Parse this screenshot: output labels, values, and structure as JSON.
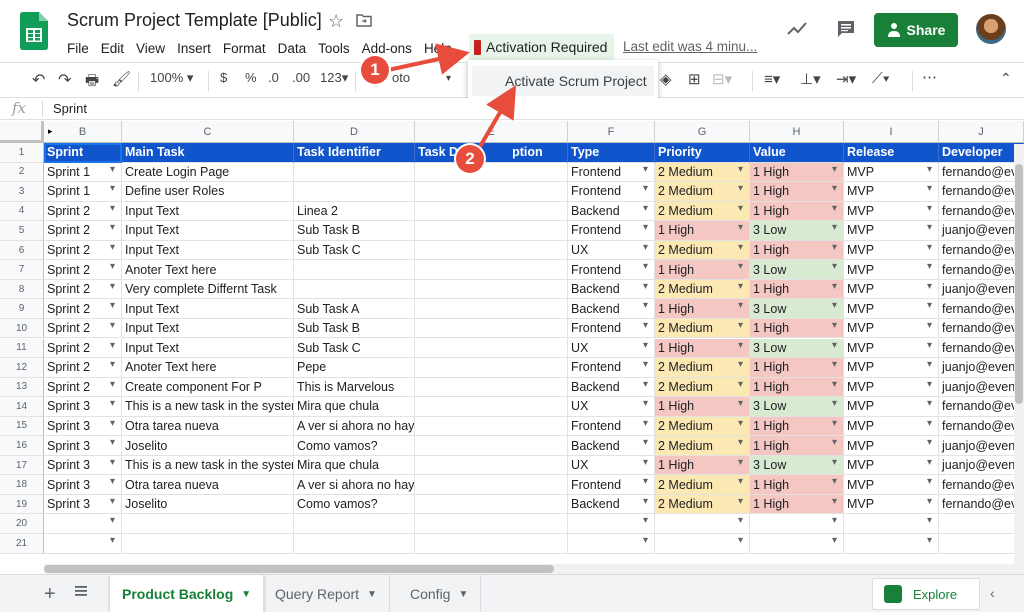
{
  "header": {
    "title": "Scrum Project Template [Public]",
    "menus": [
      "File",
      "Edit",
      "View",
      "Insert",
      "Format",
      "Data",
      "Tools",
      "Add-ons",
      "Help"
    ],
    "activation_menu": "Activation Required",
    "last_edit": "Last edit was 4 minu...",
    "share_label": "Share",
    "icons": [
      "sheets-logo-icon",
      "star-icon",
      "folder-icon",
      "trend-icon",
      "comment-icon",
      "person-icon"
    ]
  },
  "toolbar": {
    "zoom": "100%",
    "currency": "$",
    "percent": "%",
    "decimal_decrease": ".0",
    "decimal_increase": ".00",
    "more_formats": "123",
    "font": "oto",
    "more": "⋯"
  },
  "dropdown": {
    "item": "Activate Scrum Project"
  },
  "formula_bar": {
    "fx": "fx",
    "value": "Sprint"
  },
  "grid": {
    "column_letters": [
      "B",
      "C",
      "D",
      "E",
      "F",
      "G",
      "H",
      "I",
      "J"
    ],
    "headers": [
      "Sprint",
      "Main Task",
      "Task Identifier",
      "Task D",
      "ption",
      "Type",
      "Priority",
      "Value",
      "Release",
      "Developer"
    ],
    "rows": [
      {
        "n": "2",
        "sprint": "Sprint 1",
        "task": "Create Login Page",
        "id": "",
        "type": "Frontend",
        "priority": "2 Medium",
        "value": "1 High",
        "release": "MVP",
        "dev": "fernando@evenl"
      },
      {
        "n": "3",
        "sprint": "Sprint 1",
        "task": "Define user Roles",
        "id": "",
        "type": "Frontend",
        "priority": "2 Medium",
        "value": "1 High",
        "release": "MVP",
        "dev": "fernando@evenl"
      },
      {
        "n": "4",
        "sprint": "Sprint 2",
        "task": "Input Text",
        "id": "Linea 2",
        "type": "Backend",
        "priority": "2 Medium",
        "value": "1 High",
        "release": "MVP",
        "dev": "fernando@evenl"
      },
      {
        "n": "5",
        "sprint": "Sprint 2",
        "task": "Input Text",
        "id": "Sub Task B",
        "type": "Frontend",
        "priority": "1 High",
        "value": "3 Low",
        "release": "MVP",
        "dev": "juanjo@evenl"
      },
      {
        "n": "6",
        "sprint": "Sprint 2",
        "task": "Input Text",
        "id": "Sub Task C",
        "type": "UX",
        "priority": "2 Medium",
        "value": "1 High",
        "release": "MVP",
        "dev": "fernando@evenl"
      },
      {
        "n": "7",
        "sprint": "Sprint 2",
        "task": "Anoter Text here",
        "id": "",
        "type": "Frontend",
        "priority": "1 High",
        "value": "3 Low",
        "release": "MVP",
        "dev": "fernando@evenl"
      },
      {
        "n": "8",
        "sprint": "Sprint 2",
        "task": "Very complete Differnt Task",
        "id": "",
        "type": "Backend",
        "priority": "2 Medium",
        "value": "1 High",
        "release": "MVP",
        "dev": "juanjo@evenl"
      },
      {
        "n": "9",
        "sprint": "Sprint 2",
        "task": "Input Text",
        "id": "Sub Task A",
        "type": "Backend",
        "priority": "1 High",
        "value": "3 Low",
        "release": "MVP",
        "dev": "fernando@evenl"
      },
      {
        "n": "10",
        "sprint": "Sprint 2",
        "task": "Input Text",
        "id": "Sub Task B",
        "type": "Frontend",
        "priority": "2 Medium",
        "value": "1 High",
        "release": "MVP",
        "dev": "fernando@evenl"
      },
      {
        "n": "11",
        "sprint": "Sprint 2",
        "task": "Input Text",
        "id": "Sub Task C",
        "type": "UX",
        "priority": "1 High",
        "value": "3 Low",
        "release": "MVP",
        "dev": "fernando@evenl"
      },
      {
        "n": "12",
        "sprint": "Sprint 2",
        "task": "Anoter Text here",
        "id": "Pepe",
        "type": "Frontend",
        "priority": "2 Medium",
        "value": "1 High",
        "release": "MVP",
        "dev": "juanjo@evenl"
      },
      {
        "n": "13",
        "sprint": "Sprint 2",
        "task": "Create component For P",
        "id": "This is Marvelous",
        "type": "Backend",
        "priority": "2 Medium",
        "value": "1 High",
        "release": "MVP",
        "dev": "juanjo@evenl"
      },
      {
        "n": "14",
        "sprint": "Sprint 3",
        "task": "This is a new task in the systen",
        "id": "Mira que chula",
        "type": "UX",
        "priority": "1 High",
        "value": "3 Low",
        "release": "MVP",
        "dev": "fernando@evenl"
      },
      {
        "n": "15",
        "sprint": "Sprint 3",
        "task": "Otra tarea nueva",
        "id": "A ver si ahora no hay log",
        "type": "Frontend",
        "priority": "2 Medium",
        "value": "1 High",
        "release": "MVP",
        "dev": "fernando@evenl"
      },
      {
        "n": "16",
        "sprint": "Sprint 3",
        "task": "Joselito",
        "id": "Como vamos?",
        "type": "Backend",
        "priority": "2 Medium",
        "value": "1 High",
        "release": "MVP",
        "dev": "juanjo@evenl"
      },
      {
        "n": "17",
        "sprint": "Sprint 3",
        "task": "This is a new task in the systen",
        "id": "Mira que chula",
        "type": "UX",
        "priority": "1 High",
        "value": "3 Low",
        "release": "MVP",
        "dev": "juanjo@evenl"
      },
      {
        "n": "18",
        "sprint": "Sprint 3",
        "task": "Otra tarea nueva",
        "id": "A ver si ahora no hay log",
        "type": "Frontend",
        "priority": "2 Medium",
        "value": "1 High",
        "release": "MVP",
        "dev": "fernando@evenl"
      },
      {
        "n": "19",
        "sprint": "Sprint 3",
        "task": "Joselito",
        "id": "Como vamos?",
        "type": "Backend",
        "priority": "2 Medium",
        "value": "1 High",
        "release": "MVP",
        "dev": "fernando@evenl"
      },
      {
        "n": "20",
        "sprint": "",
        "task": "",
        "id": "",
        "type": "",
        "priority": "",
        "value": "",
        "release": "",
        "dev": ""
      },
      {
        "n": "21",
        "sprint": "",
        "task": "",
        "id": "",
        "type": "",
        "priority": "",
        "value": "",
        "release": "",
        "dev": ""
      }
    ]
  },
  "sheets": {
    "tabs": [
      "Product Backlog",
      "Query Report",
      "Config"
    ],
    "active": "Product Backlog",
    "explore": "Explore"
  },
  "annotations": {
    "step1": "1",
    "step2": "2"
  },
  "colors": {
    "header_blue": "#1155cc",
    "share_green": "#188038",
    "medium_yellow": "#fce8b2",
    "high_red": "#f4c7c3",
    "low_green": "#d9ead3",
    "annotation_red": "#e74c3c"
  }
}
